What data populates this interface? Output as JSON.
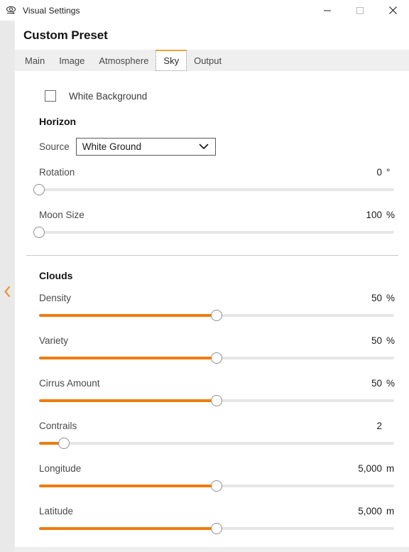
{
  "window": {
    "title": "Visual Settings",
    "icon": "eye-settings-icon",
    "controls": {
      "minimize": "minimize-icon",
      "maximize": "maximize-icon",
      "close": "close-icon"
    }
  },
  "rail": {
    "collapse_icon": "chevron-left-icon"
  },
  "preset": {
    "title": "Custom Preset"
  },
  "tabs": {
    "items": [
      {
        "label": "Main",
        "active": false
      },
      {
        "label": "Image",
        "active": false
      },
      {
        "label": "Atmosphere",
        "active": false
      },
      {
        "label": "Sky",
        "active": true
      },
      {
        "label": "Output",
        "active": false
      }
    ],
    "active_index": 3,
    "active_accent": "#e8a33d"
  },
  "content": {
    "white_background": {
      "label": "White Background",
      "checked": false
    },
    "horizon": {
      "title": "Horizon",
      "source": {
        "label": "Source",
        "value": "White Ground",
        "caret_icon": "chevron-down-icon"
      },
      "sliders": [
        {
          "label": "Rotation",
          "value": "0",
          "unit": "°",
          "percent": 0
        },
        {
          "label": "Moon Size",
          "value": "100",
          "unit": "%",
          "percent": 0
        }
      ]
    },
    "clouds": {
      "title": "Clouds",
      "sliders": [
        {
          "label": "Density",
          "value": "50",
          "unit": "%",
          "percent": 50
        },
        {
          "label": "Variety",
          "value": "50",
          "unit": "%",
          "percent": 50
        },
        {
          "label": "Cirrus Amount",
          "value": "50",
          "unit": "%",
          "percent": 50
        },
        {
          "label": "Contrails",
          "value": "2",
          "unit": "",
          "percent": 7
        },
        {
          "label": "Longitude",
          "value": "5,000",
          "unit": "m",
          "percent": 50
        },
        {
          "label": "Latitude",
          "value": "5,000",
          "unit": "m",
          "percent": 50
        }
      ]
    }
  },
  "colors": {
    "accent_orange": "#ed7d0e",
    "tab_accent": "#e8a33d",
    "track": "#e6e6e6",
    "rail_bg": "#e9e9e9",
    "tabstrip_bg": "#efefef"
  }
}
